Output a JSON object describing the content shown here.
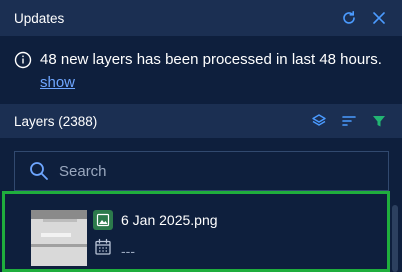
{
  "header": {
    "title": "Updates",
    "refresh_icon": "refresh-icon",
    "close_icon": "close-icon"
  },
  "notice": {
    "icon": "info-icon",
    "message": "48 new layers has been processed in last 48 hours.",
    "link_label": "show"
  },
  "layers_bar": {
    "label": "Layers (2388)",
    "icons": [
      "layers-icon",
      "sort-icon",
      "filter-icon"
    ],
    "filter_color": "#22b573"
  },
  "search": {
    "placeholder": "Search",
    "value": ""
  },
  "list": {
    "items": [
      {
        "name": "6 Jan 2025.png",
        "date": "---",
        "type_icon": "image-icon",
        "date_icon": "calendar-icon"
      }
    ]
  },
  "colors": {
    "background": "#0e1f3d",
    "header_bg": "#1b2f52",
    "link": "#6ea6ff",
    "accent_icon": "#4b9bff",
    "selection_border": "#1fae3d"
  }
}
